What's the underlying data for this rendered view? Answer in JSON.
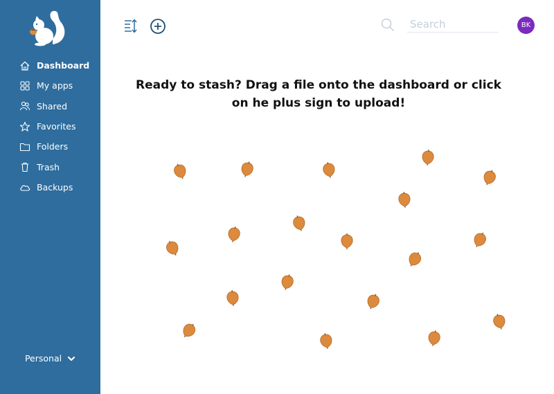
{
  "sidebar": {
    "items": [
      {
        "label": "Dashboard",
        "icon": "home-icon",
        "active": true
      },
      {
        "label": "My apps",
        "icon": "apps-grid-icon",
        "active": false
      },
      {
        "label": "Shared",
        "icon": "users-icon",
        "active": false
      },
      {
        "label": "Favorites",
        "icon": "star-icon",
        "active": false
      },
      {
        "label": "Folders",
        "icon": "folder-icon",
        "active": false
      },
      {
        "label": "Trash",
        "icon": "trash-icon",
        "active": false
      },
      {
        "label": "Backups",
        "icon": "cloud-icon",
        "active": false
      }
    ],
    "account_label": "Personal"
  },
  "search": {
    "placeholder": "Search"
  },
  "user": {
    "initials": "BK"
  },
  "main": {
    "headline_line1": "Ready to stash? Drag a file onto the dashboard or click",
    "headline_line2": "on he plus sign to upload!"
  },
  "colors": {
    "sidebar": "#2e6d9e",
    "avatar": "#7b2bbd",
    "acorn": "#dc8a3e",
    "toolbar_icon": "#2e6d9e"
  }
}
